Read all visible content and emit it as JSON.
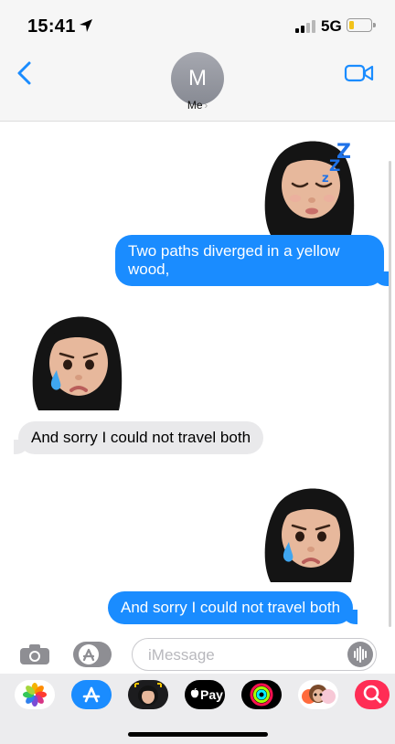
{
  "status_bar": {
    "time": "15:41",
    "network": "5G"
  },
  "header": {
    "avatar_initial": "M",
    "contact_name": "Me",
    "chevron": "›"
  },
  "messages": [
    {
      "direction": "outgoing",
      "kind": "memoji",
      "icon": "sleeping-memoji-icon"
    },
    {
      "direction": "outgoing",
      "kind": "text",
      "line1": "Two paths diverged in a yellow",
      "line2": "wood,"
    },
    {
      "direction": "incoming",
      "kind": "memoji",
      "icon": "crying-memoji-icon"
    },
    {
      "direction": "incoming",
      "kind": "text",
      "text": "And sorry I could not travel both"
    },
    {
      "direction": "outgoing",
      "kind": "memoji",
      "icon": "crying-memoji-icon"
    },
    {
      "direction": "outgoing",
      "kind": "text",
      "text": "And sorry I could not travel both"
    }
  ],
  "composer": {
    "placeholder": "iMessage"
  },
  "app_tray": {
    "apps": [
      "photos-icon",
      "app-store-icon",
      "memoji-stickers-icon",
      "apple-pay-icon",
      "activity-icon",
      "animoji-icon",
      "image-search-icon"
    ],
    "apple_pay_label": "Pay"
  },
  "colors": {
    "accent": "#1a8cff",
    "incoming_bubble": "#e9e9eb",
    "outgoing_bubble": "#1a8cff"
  }
}
